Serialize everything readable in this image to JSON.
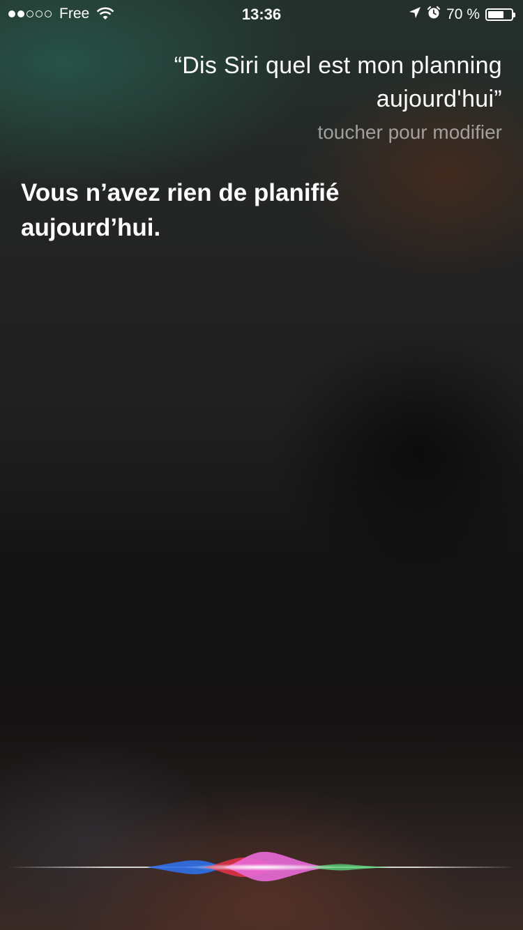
{
  "status_bar": {
    "signal_filled": 2,
    "signal_total": 5,
    "carrier": "Free",
    "time": "13:36",
    "battery_percent_label": "70 %",
    "battery_level": 0.7
  },
  "siri": {
    "query_line_1": "“Dis Siri quel est mon planning",
    "query_line_2": "aujourd'hui”",
    "edit_hint": "toucher pour modifier",
    "response_line_1": "Vous n’avez rien de planifié",
    "response_line_2": "aujourd’hui."
  },
  "icons": {
    "wifi": "wifi-icon",
    "location": "location-arrow-icon",
    "alarm": "alarm-clock-icon",
    "battery": "battery-icon",
    "siri_wave": "siri-waveform-icon"
  },
  "colors": {
    "wave_blue": "#2f6fe8",
    "wave_red": "#e8324a",
    "wave_pink": "#e86ad8",
    "wave_green": "#5ad27a"
  }
}
